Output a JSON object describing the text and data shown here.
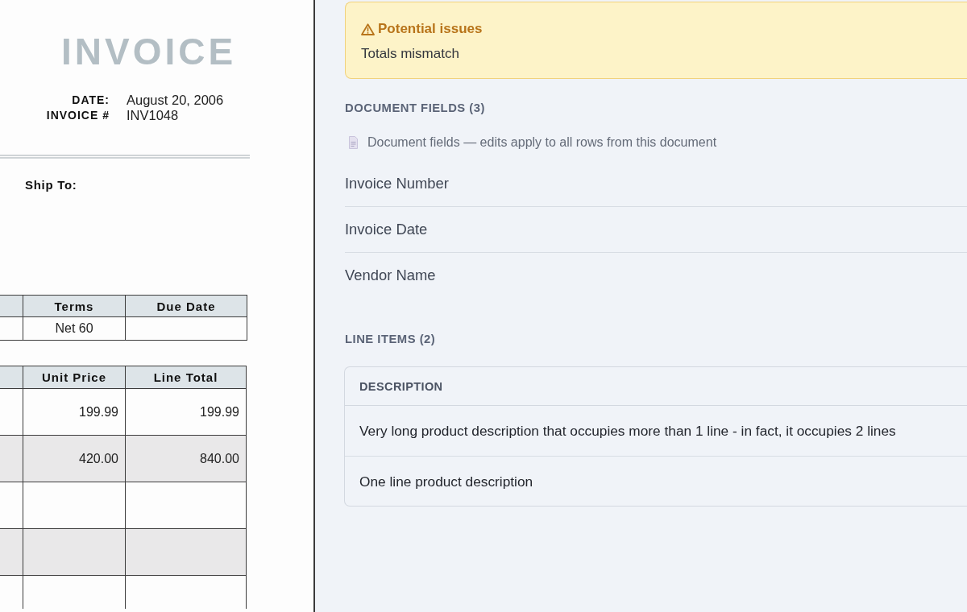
{
  "invoice_document": {
    "title": "INVOICE",
    "meta": [
      {
        "label": "DATE:",
        "value": "August 20, 2006"
      },
      {
        "label": "INVOICE #",
        "value": "INV1048"
      }
    ],
    "ship_to_label": "Ship To:",
    "terms_table": {
      "columns": [
        "Terms",
        "Due Date"
      ],
      "rows": [
        {
          "cells": [
            "Net 60"
          ]
        }
      ]
    },
    "items_table": {
      "columns": [
        "Unit Price",
        "Line Total"
      ],
      "rows": [
        {
          "cells": [
            "199.99",
            "199.99"
          ]
        },
        {
          "cells": [
            "420.00",
            "840.00"
          ]
        }
      ]
    }
  },
  "review_panel": {
    "issues": {
      "title": "Potential issues",
      "messages": [
        "Totals mismatch"
      ]
    },
    "document_fields": {
      "heading": "DOCUMENT FIELDS (3)",
      "note": "Document fields — edits apply to all rows from this document",
      "fields": [
        {
          "label": "Invoice Number"
        },
        {
          "label": "Invoice Date"
        },
        {
          "label": "Vendor Name"
        }
      ]
    },
    "line_items": {
      "heading": "LINE ITEMS (2)",
      "columns": [
        "DESCRIPTION"
      ],
      "rows": [
        {
          "description": "Very long product description that occupies more than 1 line - in fact, it occupies 2 lines"
        },
        {
          "description": "One line product description"
        }
      ]
    }
  }
}
